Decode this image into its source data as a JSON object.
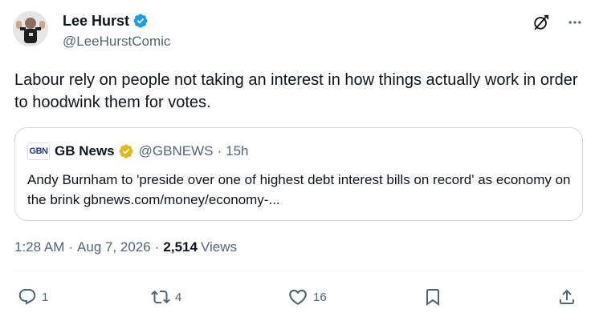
{
  "author": {
    "name": "Lee Hurst",
    "handle": "@LeeHurstComic"
  },
  "tweet": {
    "text": "Labour rely on people not taking an interest in how things actually work in order to hoodwink them for votes."
  },
  "quote": {
    "logo_text": "GBN",
    "name": "GB News",
    "handle": "@GBNEWS",
    "separator": "·",
    "time": "15h",
    "text": "Andy Burnham to 'preside over one of highest debt interest bills on record' as economy on the brink gbnews.com/money/economy-..."
  },
  "meta": {
    "time": "1:28 AM",
    "date": "Aug 7, 2026",
    "separator": "·",
    "views_count": "2,514",
    "views_label": "Views"
  },
  "actions": {
    "replies": "1",
    "reposts": "4",
    "likes": "16"
  },
  "icons": {
    "verified": "verified-badge-icon",
    "gold_verified": "gold-verified-badge-icon",
    "grok": "grok-icon",
    "more": "more-icon",
    "reply": "reply-icon",
    "repost": "repost-icon",
    "like": "heart-icon",
    "bookmark": "bookmark-icon",
    "share": "share-icon"
  },
  "colors": {
    "blue_verified": "#1d9bf0",
    "gold_verified": "#e2b719",
    "secondary_text": "#536471",
    "primary_text": "#0f1419"
  }
}
